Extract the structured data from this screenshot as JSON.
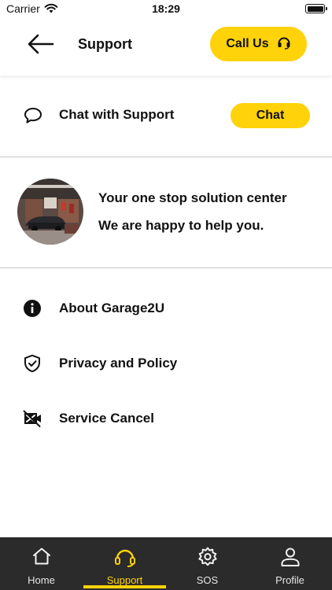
{
  "status_bar": {
    "carrier": "Carrier",
    "time": "18:29"
  },
  "header": {
    "title": "Support",
    "call_label": "Call Us"
  },
  "chat": {
    "label": "Chat with Support",
    "button": "Chat"
  },
  "banner": {
    "line1": "Your one stop solution center",
    "line2": "We are happy to help you."
  },
  "menu": [
    {
      "label": "About Garage2U",
      "icon": "info-icon"
    },
    {
      "label": "Privacy and Policy",
      "icon": "shield-check-icon"
    },
    {
      "label": "Service Cancel",
      "icon": "video-off-icon"
    }
  ],
  "bottom_nav": [
    {
      "label": "Home",
      "icon": "home-icon"
    },
    {
      "label": "Support",
      "icon": "headset-icon",
      "active": true
    },
    {
      "label": "SOS",
      "icon": "gear-icon"
    },
    {
      "label": "Profile",
      "icon": "user-icon"
    }
  ],
  "colors": {
    "accent": "#FFD209",
    "nav_bg": "#2b2b2b",
    "text": "#111111"
  }
}
